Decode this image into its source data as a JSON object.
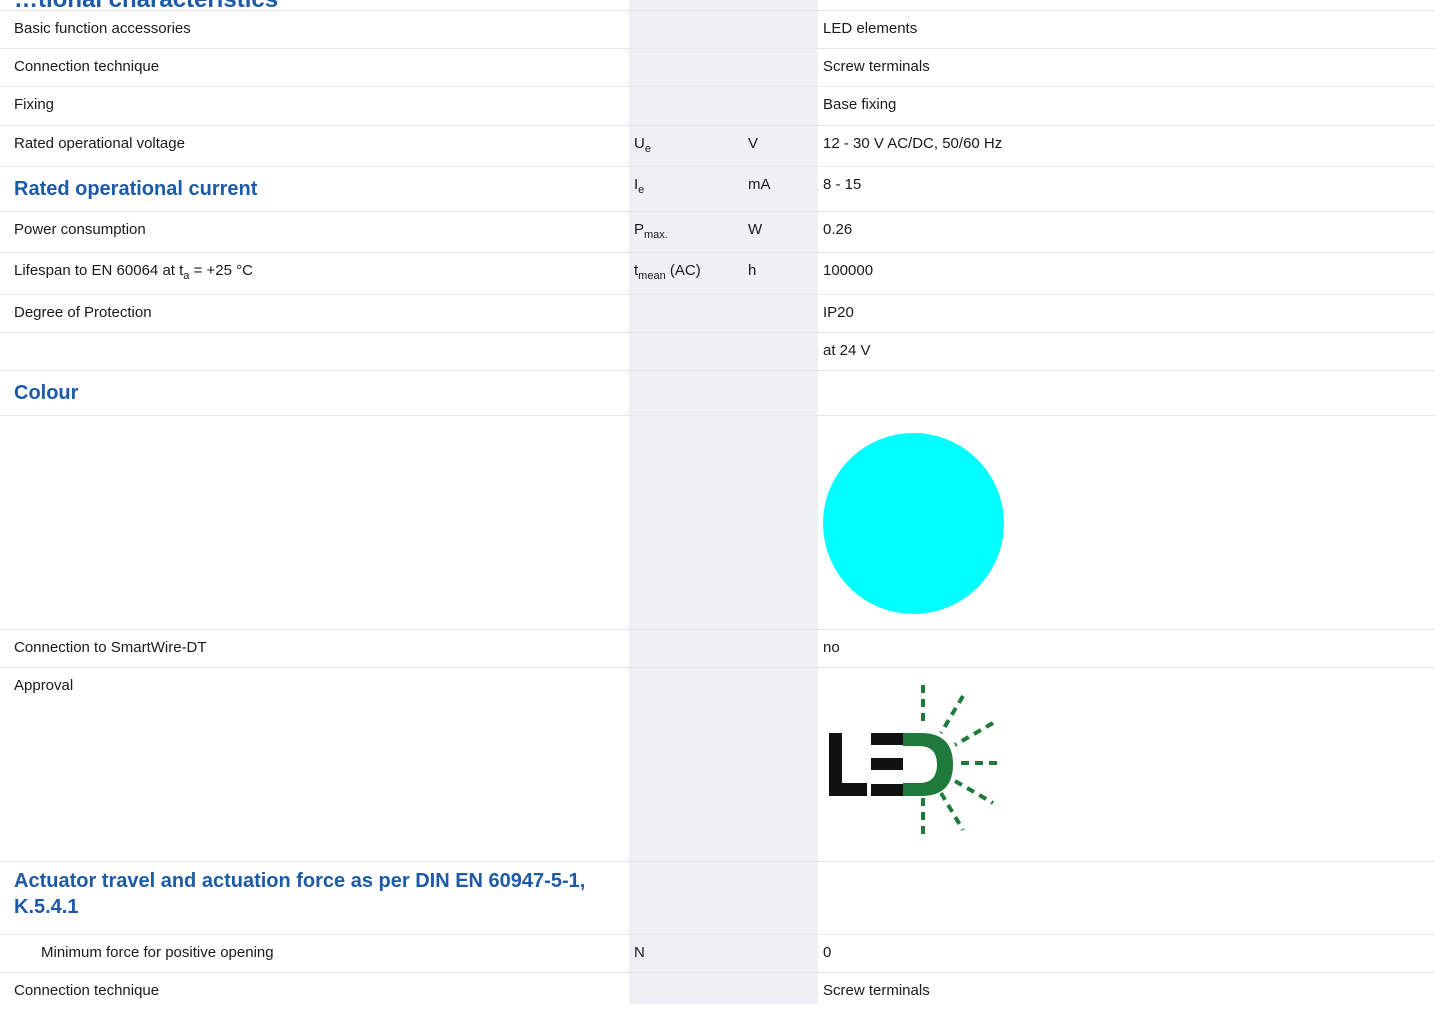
{
  "page": {
    "cut_title": "…tional characteristics"
  },
  "rows": {
    "basic_function": {
      "label": "Basic function accessories",
      "value": "LED elements"
    },
    "connection_technique": {
      "label": "Connection technique",
      "value": "Screw terminals"
    },
    "fixing": {
      "label": "Fixing",
      "value": "Base fixing"
    },
    "rated_voltage": {
      "label": "Rated operational voltage",
      "symbol": "U",
      "symbol_sub": "e",
      "unit": "V",
      "value": "12 - 30 V AC/DC, 50/60 Hz"
    },
    "rated_current": {
      "label": "Rated operational current",
      "symbol": "I",
      "symbol_sub": "e",
      "unit": "mA",
      "value": "8 - 15"
    },
    "power_consumption": {
      "label": "Power consumption",
      "symbol": "P",
      "symbol_sub": "max.",
      "unit": "W",
      "value": "0.26"
    },
    "lifespan": {
      "label_pre": "Lifespan to EN 60064 at t",
      "label_sub": "a",
      "label_post": " = +25 °C",
      "symbol": "t",
      "symbol_sub": "mean",
      "symbol_post": " (AC)",
      "unit": "h",
      "value": "100000"
    },
    "degree_protection": {
      "label": "Degree of Protection",
      "value": "IP20"
    },
    "at_24v": {
      "value": "at 24 V"
    },
    "colour": {
      "label": "Colour",
      "swatch_color": "#00ffff"
    },
    "smartwire": {
      "label": "Connection to SmartWire-DT",
      "value": "no"
    },
    "approval": {
      "label": "Approval",
      "logo_text": "LED",
      "logo_colors": {
        "dark": "#111111",
        "green": "#1e7a3a"
      }
    },
    "actuator": {
      "label": "Actuator travel and actuation force as per DIN EN 60947-5-1, K.5.4.1"
    },
    "min_force": {
      "label": "Minimum force for positive opening",
      "symbol": "N",
      "value": "0"
    },
    "connection_technique_2": {
      "label": "Connection technique",
      "value": "Screw terminals"
    }
  }
}
